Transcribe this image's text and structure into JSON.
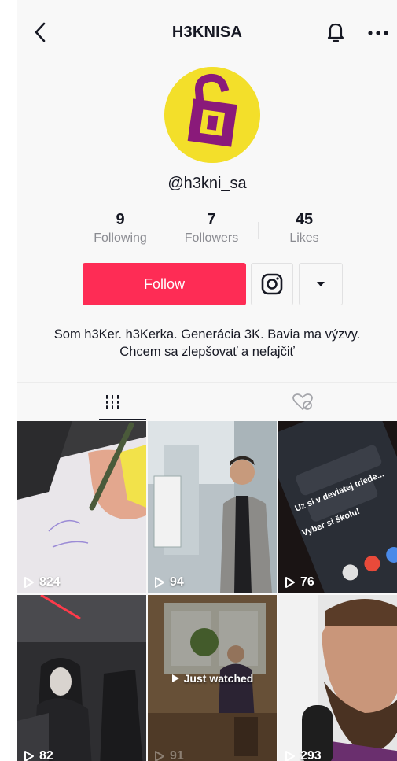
{
  "header": {
    "title": "H3KNISA",
    "back_icon": "chevron-left-icon",
    "bell_icon": "bell-icon",
    "more_icon": "more-horizontal-icon"
  },
  "profile": {
    "handle": "@h3kni_sa",
    "avatar_bg": "#f3df2a",
    "avatar_fg": "#8a1a7a"
  },
  "stats": [
    {
      "value": "9",
      "label": "Following"
    },
    {
      "value": "7",
      "label": "Followers"
    },
    {
      "value": "45",
      "label": "Likes"
    }
  ],
  "actions": {
    "follow_label": "Follow",
    "follow_color": "#fe2c55",
    "instagram_icon": "instagram-icon",
    "dropdown_icon": "caret-down-icon"
  },
  "bio": "Som h3Ker. h3Kerka. Generácia 3K. Bavia ma výzvy. Chcem sa zlepšovať a nefajčiť",
  "tabs": [
    {
      "icon": "videos-grid-icon",
      "active": true
    },
    {
      "icon": "liked-heart-icon",
      "active": false
    }
  ],
  "videos": [
    {
      "views": "824"
    },
    {
      "views": "94"
    },
    {
      "views": "76"
    },
    {
      "views": "82"
    },
    {
      "views": "91",
      "badge": "Just watched"
    },
    {
      "views": "293"
    }
  ]
}
